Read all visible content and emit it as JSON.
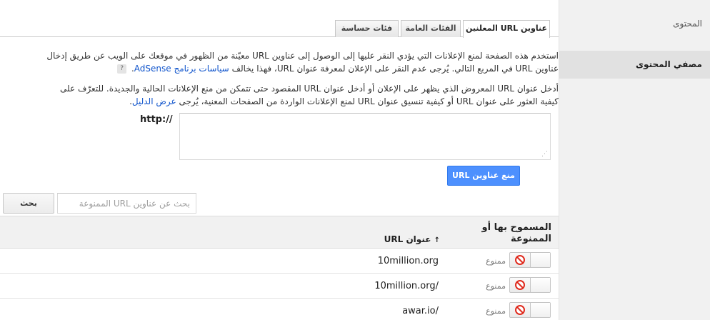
{
  "sidebar": {
    "content_label": "المحتوى",
    "content_filter_label": "مصفي المحتوى"
  },
  "tabs": [
    {
      "label": "عناوين URL المعلنين",
      "active": true
    },
    {
      "label": "الفئات العامة",
      "active": false
    },
    {
      "label": "فئات حساسة",
      "active": false
    }
  ],
  "intro": {
    "line1": "استخدم هذه الصفحة لمنع الإعلانات التي يؤدي النقر عليها إلى الوصول إلى عناوين URL معيّنة من الظهور في موقعك على الويب عن طريق إدخال",
    "line2_text": "عناوين URL في المربع التالي. يُرجى عدم النقر على الإعلان لمعرفة عنوان URL، فهذا يخالف",
    "line2_link": "سياسات برنامج AdSense",
    "line2_end": ".",
    "help_icon": "?"
  },
  "instructions": {
    "line1": "أدخل عنوان URL المعروض الذي يظهر على الإعلان أو أدخل عنوان URL المقصود حتى تتمكن من منع الإعلانات الحالية والجديدة. للتعرّف على",
    "line2_text": "كيفية العثور على عنوان URL أو كيفية تنسيق عنوان URL لمنع الإعلانات الواردة من الصفحات المعنية، يُرجى",
    "line2_link": "عرض الدليل",
    "line2_end": "."
  },
  "url_input": {
    "prefix": "http://",
    "value": "",
    "resize_grip": "⋰"
  },
  "block_button_label": "منع عناوين URL",
  "search": {
    "placeholder": "بحث عن عناوين URL الممنوعة",
    "button_label": "بحث"
  },
  "table": {
    "columns": {
      "status": "المسموح بها أو الممنوعة",
      "url": "عنوان URL",
      "sort_icon": "↑"
    },
    "rows": [
      {
        "url": "10million.org",
        "status": "ممنوع"
      },
      {
        "url": "10million.org/",
        "status": "ممنوع"
      },
      {
        "url": "awar.io/",
        "status": "ممنوع"
      }
    ]
  },
  "colors": {
    "primary_button": "#4d90fe",
    "link": "#1155cc",
    "block_icon": "#e02b1e",
    "sidebar_bg": "#f1f1f1",
    "sidebar_selected_bg": "#e1e1e1"
  },
  "icons": {
    "help": "help-icon",
    "sort": "sort-ascending-icon",
    "block": "block-icon"
  }
}
